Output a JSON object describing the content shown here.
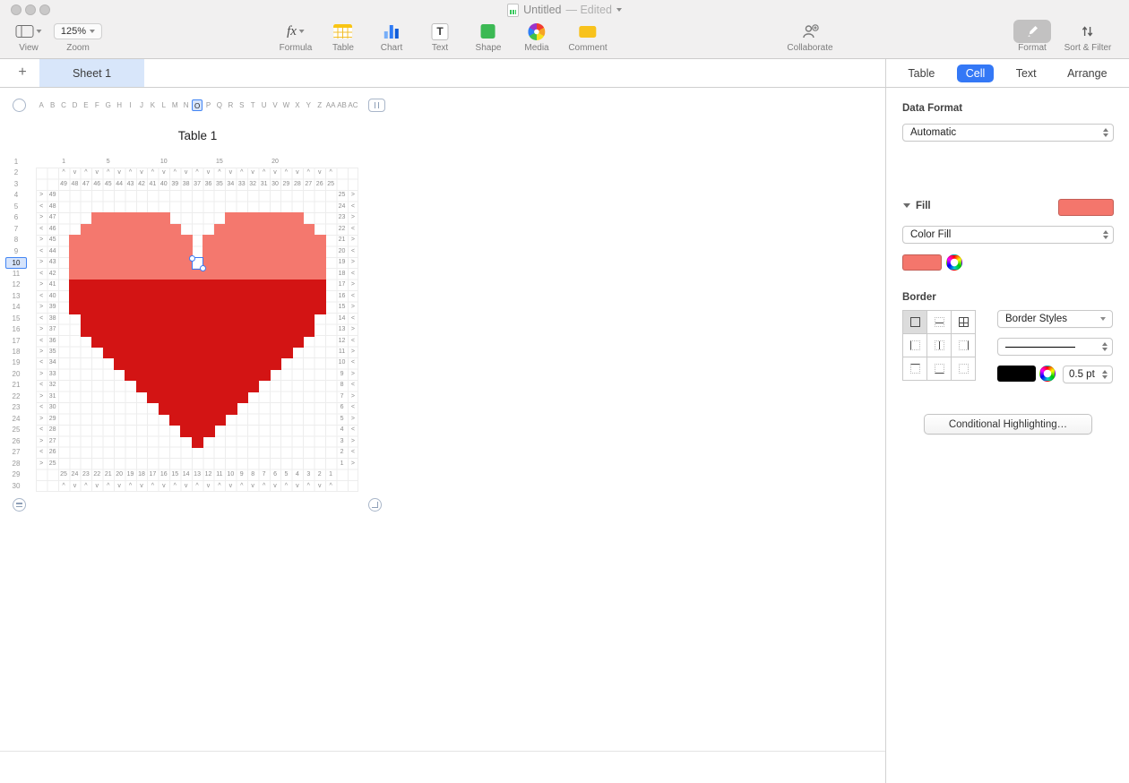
{
  "window": {
    "title": "Untitled",
    "edited_suffix": "— Edited"
  },
  "toolbar": {
    "view_label": "View",
    "zoom_label": "Zoom",
    "zoom_value": "125%",
    "formula_icon_text": "fx",
    "formula_label": "Formula",
    "table_label": "Table",
    "chart_label": "Chart",
    "text_icon_letter": "T",
    "text_label": "Text",
    "shape_label": "Shape",
    "media_label": "Media",
    "comment_label": "Comment",
    "collaborate_label": "Collaborate",
    "format_label": "Format",
    "sort_filter_label": "Sort & Filter"
  },
  "sheet_bar": {
    "add_button": "+",
    "active_tab": "Sheet 1"
  },
  "canvas": {
    "table_title": "Table 1",
    "column_letters": [
      "A",
      "B",
      "C",
      "D",
      "E",
      "F",
      "G",
      "H",
      "I",
      "J",
      "K",
      "L",
      "M",
      "N",
      "O",
      "P",
      "Q",
      "R",
      "S",
      "T",
      "U",
      "V",
      "W",
      "X",
      "Y",
      "Z",
      "AA",
      "AB",
      "AC"
    ],
    "row_count": 30,
    "selection": {
      "column_letter": "O",
      "row_number": 10,
      "data_col": 13
    },
    "scale_labels": [
      {
        "col": 1,
        "label": "1"
      },
      {
        "col": 5,
        "label": "5"
      },
      {
        "col": 10,
        "label": "10"
      },
      {
        "col": 15,
        "label": "15"
      },
      {
        "col": 20,
        "label": "20"
      }
    ],
    "grid": {
      "top_numbers": [
        49,
        48,
        47,
        46,
        45,
        44,
        43,
        42,
        41,
        40,
        39,
        38,
        37,
        36,
        35,
        34,
        33,
        32,
        31,
        30,
        29,
        28,
        27,
        26,
        25
      ],
      "left_numbers": [
        49,
        48,
        47,
        46,
        45,
        44,
        43,
        42,
        41,
        40,
        39,
        38,
        37,
        36,
        35,
        34,
        33,
        32,
        31,
        30,
        29,
        28,
        27,
        26,
        25
      ],
      "right_numbers": [
        25,
        24,
        23,
        22,
        21,
        20,
        19,
        18,
        17,
        16,
        15,
        14,
        13,
        12,
        11,
        10,
        9,
        8,
        7,
        6,
        5,
        4,
        3,
        2,
        1
      ],
      "bottom_numbers": [
        25,
        24,
        23,
        22,
        21,
        20,
        19,
        18,
        17,
        16,
        15,
        14,
        13,
        12,
        11,
        10,
        9,
        8,
        7,
        6,
        5,
        4,
        3,
        2,
        1
      ],
      "top_symbols": [
        "^",
        "v"
      ],
      "side_symbols": [
        ">",
        "<"
      ]
    },
    "heart": {
      "colors": {
        "pink": "#f4786e",
        "red": "#d31414"
      },
      "rows": [
        {
          "row": 3,
          "color": "pink",
          "spans": [
            [
              4,
              10
            ],
            [
              16,
              22
            ]
          ]
        },
        {
          "row": 4,
          "color": "pink",
          "spans": [
            [
              3,
              11
            ],
            [
              15,
              23
            ]
          ]
        },
        {
          "row": 5,
          "color": "pink",
          "spans": [
            [
              2,
              12
            ],
            [
              14,
              24
            ]
          ]
        },
        {
          "row": 6,
          "color": "pink",
          "spans": [
            [
              2,
              12
            ],
            [
              14,
              24
            ]
          ]
        },
        {
          "row": 7,
          "color": "pink",
          "spans": [
            [
              2,
              12
            ],
            [
              14,
              24
            ]
          ]
        },
        {
          "row": 8,
          "color": "pink",
          "spans": [
            [
              2,
              24
            ]
          ]
        },
        {
          "row": 9,
          "color": "red",
          "spans": [
            [
              2,
              24
            ]
          ]
        },
        {
          "row": 10,
          "color": "red",
          "spans": [
            [
              2,
              24
            ]
          ]
        },
        {
          "row": 11,
          "color": "red",
          "spans": [
            [
              2,
              24
            ]
          ]
        },
        {
          "row": 12,
          "color": "red",
          "spans": [
            [
              3,
              23
            ]
          ]
        },
        {
          "row": 13,
          "color": "red",
          "spans": [
            [
              3,
              23
            ]
          ]
        },
        {
          "row": 14,
          "color": "red",
          "spans": [
            [
              4,
              22
            ]
          ]
        },
        {
          "row": 15,
          "color": "red",
          "spans": [
            [
              5,
              21
            ]
          ]
        },
        {
          "row": 16,
          "color": "red",
          "spans": [
            [
              6,
              20
            ]
          ]
        },
        {
          "row": 17,
          "color": "red",
          "spans": [
            [
              7,
              19
            ]
          ]
        },
        {
          "row": 18,
          "color": "red",
          "spans": [
            [
              8,
              18
            ]
          ]
        },
        {
          "row": 19,
          "color": "red",
          "spans": [
            [
              9,
              17
            ]
          ]
        },
        {
          "row": 20,
          "color": "red",
          "spans": [
            [
              10,
              16
            ]
          ]
        },
        {
          "row": 21,
          "color": "red",
          "spans": [
            [
              11,
              15
            ]
          ]
        },
        {
          "row": 22,
          "color": "red",
          "spans": [
            [
              12,
              14
            ]
          ]
        },
        {
          "row": 23,
          "color": "red",
          "spans": [
            [
              13,
              13
            ]
          ]
        }
      ]
    }
  },
  "inspector": {
    "tabs": [
      {
        "label": "Table",
        "active": false
      },
      {
        "label": "Cell",
        "active": true
      },
      {
        "label": "Text",
        "active": false
      },
      {
        "label": "Arrange",
        "active": false
      }
    ],
    "data_format": {
      "label": "Data Format",
      "value": "Automatic"
    },
    "fill": {
      "label": "Fill",
      "swatch_color": "#f4766c",
      "type_value": "Color Fill",
      "well_color": "#f4766c"
    },
    "border": {
      "label": "Border",
      "styles_value": "Border Styles",
      "width_value": "0.5 pt",
      "color": "#000000"
    },
    "conditional_label": "Conditional Highlighting…"
  },
  "colors": {
    "accent_blue": "#3478f6",
    "selection_tint": "#d8e6fa"
  }
}
